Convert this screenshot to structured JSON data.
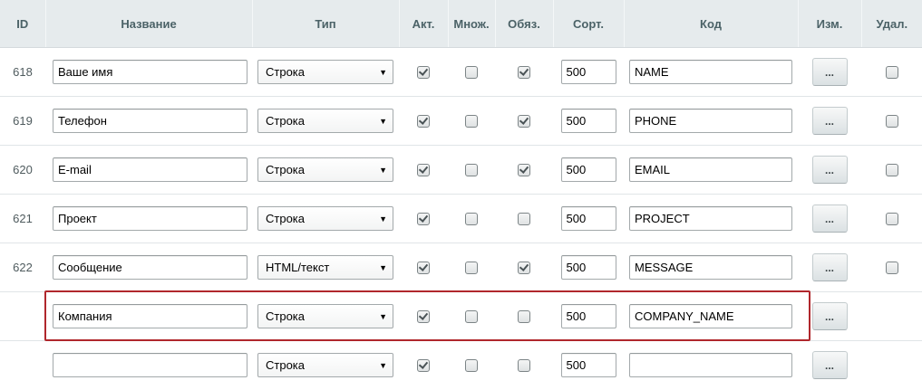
{
  "header": {
    "id": "ID",
    "name": "Название",
    "type": "Тип",
    "active": "Акт.",
    "multiple": "Множ.",
    "required": "Обяз.",
    "sort": "Сорт.",
    "code": "Код",
    "edit": "Изм.",
    "delete": "Удал."
  },
  "rows": [
    {
      "id": "618",
      "name": "Ваше имя",
      "type": "Строка",
      "active": true,
      "multiple": false,
      "required": true,
      "sort": "500",
      "code": "NAME",
      "edit_label": "...",
      "delete": false
    },
    {
      "id": "619",
      "name": "Телефон",
      "type": "Строка",
      "active": true,
      "multiple": false,
      "required": true,
      "sort": "500",
      "code": "PHONE",
      "edit_label": "...",
      "delete": false
    },
    {
      "id": "620",
      "name": "E-mail",
      "type": "Строка",
      "active": true,
      "multiple": false,
      "required": true,
      "sort": "500",
      "code": "EMAIL",
      "edit_label": "...",
      "delete": false
    },
    {
      "id": "621",
      "name": "Проект",
      "type": "Строка",
      "active": true,
      "multiple": false,
      "required": false,
      "sort": "500",
      "code": "PROJECT",
      "edit_label": "...",
      "delete": false
    },
    {
      "id": "622",
      "name": "Сообщение",
      "type": "HTML/текст",
      "active": true,
      "multiple": false,
      "required": true,
      "sort": "500",
      "code": "MESSAGE",
      "edit_label": "...",
      "delete": false
    },
    {
      "id": "",
      "name": "Компания",
      "type": "Строка",
      "active": true,
      "multiple": false,
      "required": false,
      "sort": "500",
      "code": "COMPANY_NAME",
      "edit_label": "...",
      "delete": null
    },
    {
      "id": "",
      "name": "",
      "type": "Строка",
      "active": true,
      "multiple": false,
      "required": false,
      "sort": "500",
      "code": "",
      "edit_label": "...",
      "delete": null
    }
  ],
  "colors": {
    "highlight": "#b0272c",
    "header_bg": "#e6ebed"
  }
}
